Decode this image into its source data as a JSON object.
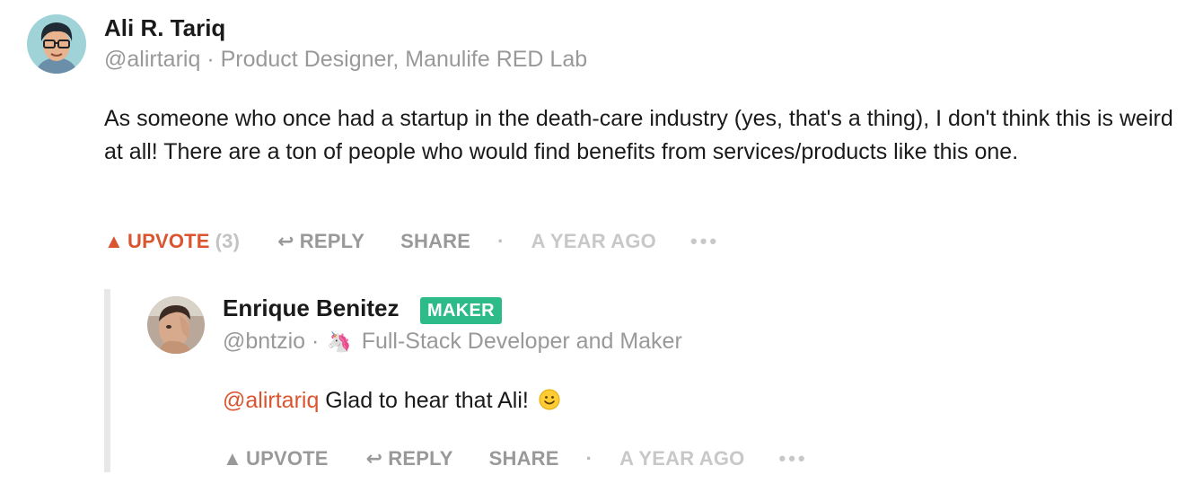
{
  "comment": {
    "author": {
      "avatar_icon": "avatar-illustrated-glasses",
      "name": "Ali R. Tariq",
      "handle": "@alirtariq",
      "separator": "·",
      "headline": "Product Designer, Manulife RED Lab"
    },
    "body": "As someone who once had a startup in the death-care industry (yes, that's a thing), I don't think this is weird at all! There are a ton of people who would find benefits from services/products like this one.",
    "actions": {
      "upvote_icon": "▲",
      "upvote_label": "UPVOTE",
      "upvote_count": "(3)",
      "reply_icon": "↩",
      "reply_label": "REPLY",
      "share_label": "SHARE",
      "separator": "·",
      "time": "A YEAR AGO",
      "more": "•••"
    }
  },
  "reply": {
    "author": {
      "avatar_icon": "avatar-photo",
      "name": "Enrique Benitez",
      "badge": "MAKER",
      "handle": "@bntzio",
      "separator": "·",
      "headline_icon": "🦄",
      "headline": "Full-Stack Developer and Maker"
    },
    "body": {
      "mention": "@alirtariq",
      "text": " Glad to hear that Ali!",
      "emoji_icon": "smiley-icon"
    },
    "actions": {
      "upvote_icon": "▲",
      "upvote_label": "UPVOTE",
      "reply_icon": "↩",
      "reply_label": "REPLY",
      "share_label": "SHARE",
      "separator": "·",
      "time": "A YEAR AGO",
      "more": "•••"
    }
  },
  "colors": {
    "accent": "#da552f",
    "maker_badge": "#2dbb8a",
    "muted_text": "#999999",
    "faint_text": "#c8c8c8",
    "thread_line": "#e8e8e8"
  }
}
